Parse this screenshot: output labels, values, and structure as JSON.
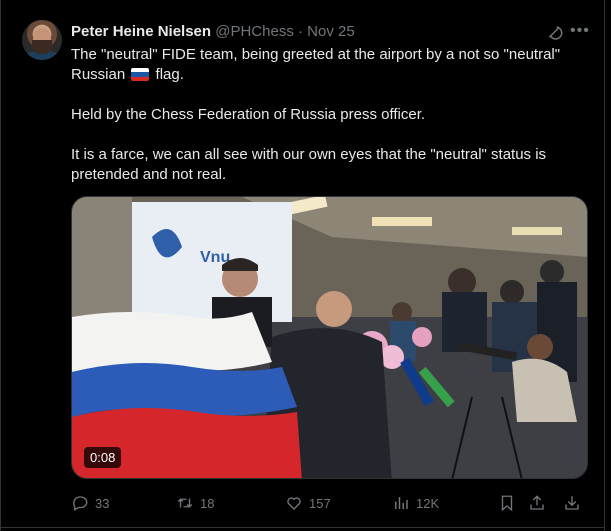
{
  "tweet": {
    "author_name": "Peter Heine Nielsen",
    "handle": "@PHChess",
    "separator": "·",
    "date": "Nov 25",
    "text_line1_a": "The \"neutral\" FIDE team, being greeted at the airport by a not so \"neutral\"",
    "text_line2_a": "Russian",
    "text_line2_b": "flag.",
    "text_para2": "Held by the Chess Federation of Russia press officer.",
    "text_para3": "It is a farce, we can all see with our own eyes that the \"neutral\" status is pretended and not real.",
    "video": {
      "timestamp": "0:08",
      "banner_text": "Vnu"
    },
    "actions": {
      "replies": "33",
      "reposts": "18",
      "likes": "157",
      "views": "12K"
    }
  },
  "colors": {
    "background": "#000000",
    "text": "#e7e9ea",
    "muted": "#71767b",
    "border": "#2f3336"
  },
  "icons": [
    "grok-icon",
    "more-icon",
    "reply-icon",
    "repost-icon",
    "like-icon",
    "views-icon",
    "bookmark-icon",
    "share-icon",
    "download-icon",
    "russian-flag-icon"
  ]
}
